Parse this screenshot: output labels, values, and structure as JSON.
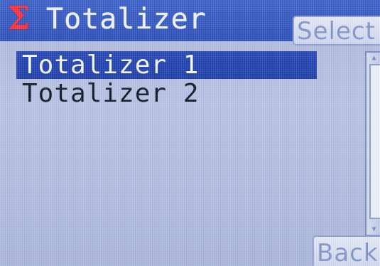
{
  "header": {
    "icon": "sigma-icon",
    "title": "Totalizer",
    "select_label": "Select",
    "accent_color": "#ff2f3b",
    "titlebar_color": "#3558c0"
  },
  "list": {
    "items": [
      {
        "label": "Totalizer 1",
        "selected": true
      },
      {
        "label": "Totalizer 2",
        "selected": false
      }
    ],
    "selected_color": "#1f3fa8"
  },
  "footer": {
    "back_label": "Back"
  }
}
